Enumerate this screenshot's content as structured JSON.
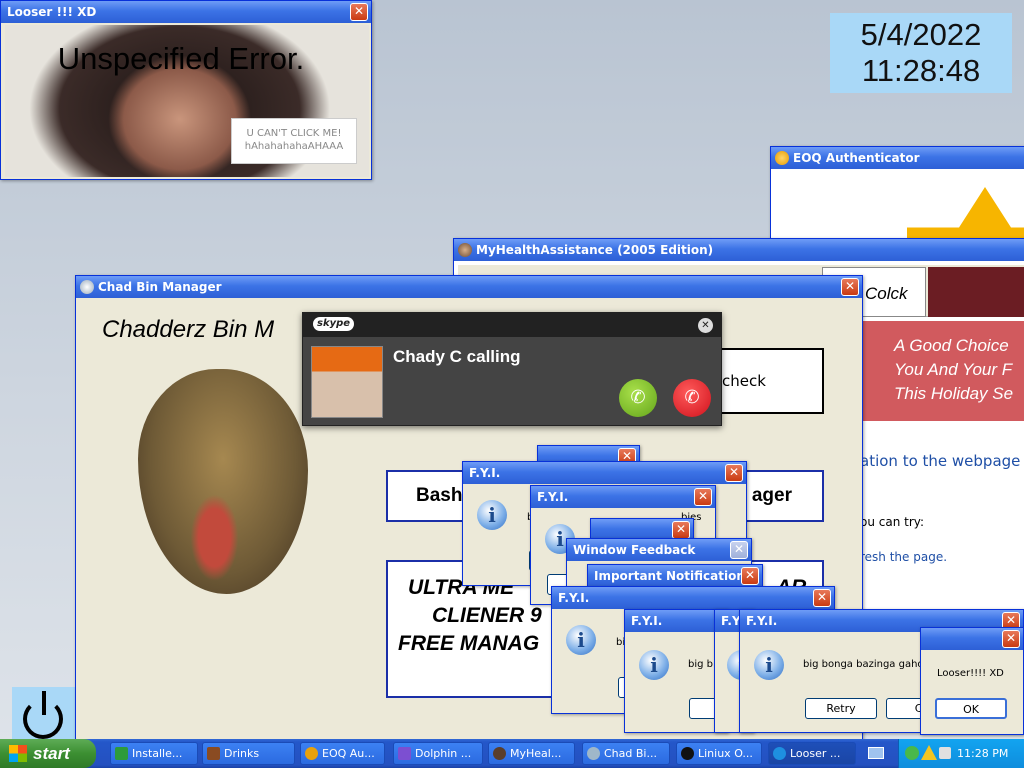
{
  "clock": {
    "date": "5/4/2022",
    "time": "11:28:48"
  },
  "looser_window": {
    "title": "Looser !!! XD",
    "heading": "Unspecified Error.",
    "button_line1": "U CAN'T CLICK ME!",
    "button_line2": "hAhahahahaAHAAA"
  },
  "eoq_window": {
    "title": "EOQ Authenticator"
  },
  "health_window": {
    "title": "MyHealthAssistance (2005 Edition)",
    "tab_clock": "Colck",
    "ad_line1": "A Good Choice",
    "ad_line2": "You And Your F",
    "ad_line3": "This Holiday Se",
    "error_text": "ation to the webpage",
    "try_text": "ou can try:",
    "refresh_text": "resh the page."
  },
  "chad_window": {
    "title": "Chad Bin Manager",
    "heading": "Chadderz Bin M",
    "check_btn": "check",
    "bash_label": "Bash",
    "manager_label": "ager",
    "ultra_line1": "ULTRA ME",
    "ultra_line1_end": "AR",
    "ultra_line2": "CLIENER 9",
    "ultra_line3": "FREE MANAG"
  },
  "skype": {
    "logo": "skype",
    "caller": "Chady C calling"
  },
  "dialogs": {
    "fyi_title": "F.Y.I.",
    "feedback_title": "Window Feedback",
    "important_title": "Important Notification",
    "message": "big bonga bazinga gahoo",
    "message_short_b": "b",
    "message_bi": "bi",
    "message_big_b": "big b",
    "message_bies": "bies",
    "retry_label": "Retry",
    "cancel_partial": "Ca",
    "looser_msg": "Looser!!!! XD",
    "ok_label": "OK"
  },
  "taskbar": {
    "start_label": "start",
    "items": [
      {
        "label": "Installe...",
        "color": "#2d9b3b"
      },
      {
        "label": "Drinks",
        "color": "#8a4b22"
      },
      {
        "label": "EOQ Au...",
        "color": "#e8a10c"
      },
      {
        "label": "Dolphin ...",
        "color": "#7c4fd1"
      },
      {
        "label": "MyHeal...",
        "color": "#5a3e2b"
      },
      {
        "label": "Chad Bi...",
        "color": "#9fb7c9"
      },
      {
        "label": "Liniux O...",
        "color": "#111111"
      },
      {
        "label": "Looser ...",
        "color": "#1e8fe0"
      }
    ],
    "tray_time": "11:28 PM"
  }
}
